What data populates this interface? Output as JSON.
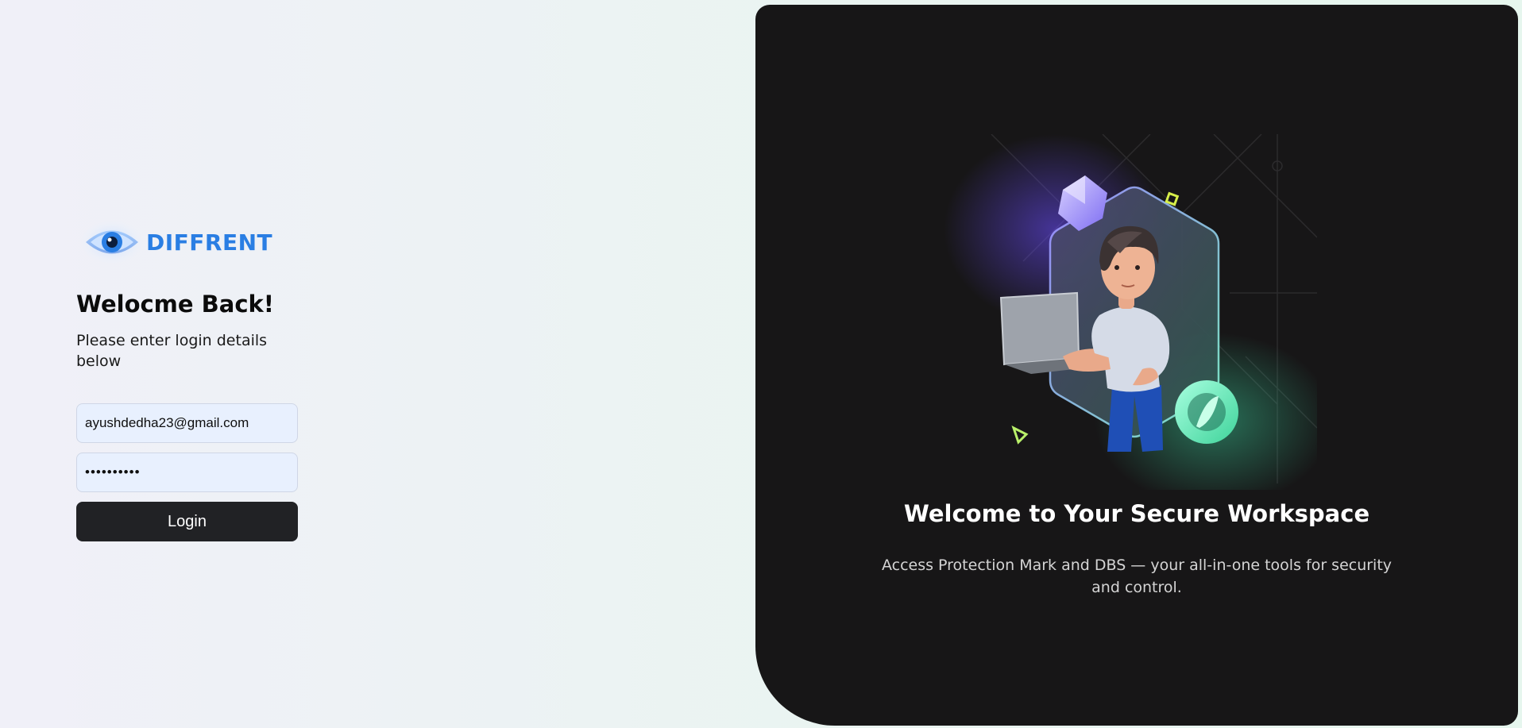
{
  "brand": {
    "name": "DIFFRENT",
    "logo_icon": "eye-icon",
    "color": "#2a7ee3"
  },
  "login": {
    "title": "Welocme Back!",
    "subtitle": "Please enter login details below",
    "email_value": "ayushdedha23@gmail.com",
    "password_value": "••••••••••",
    "login_label": "Login"
  },
  "hero": {
    "title": "Welcome to Your Secure Workspace",
    "description": "Access Protection Mark and DBS — your all-in-one tools for security and control.",
    "illustration": "person-with-laptop-illustration",
    "panel_color": "#171617"
  },
  "colors": {
    "accent": "#2a7ee3",
    "button_bg": "#212225",
    "field_bg": "#e8f0fe"
  }
}
